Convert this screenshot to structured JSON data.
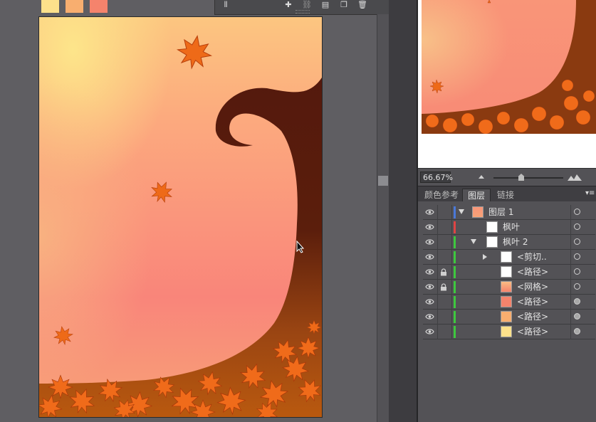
{
  "swatches": [
    {
      "name": "yellow",
      "color": "#fde18b"
    },
    {
      "name": "orange",
      "color": "#f8ae6f"
    },
    {
      "name": "salmon",
      "color": "#f5836c"
    }
  ],
  "toolbar": {
    "icons": [
      "align-icon",
      "transform-icon",
      "link-icon",
      "new-page-icon",
      "duplicate-icon",
      "delete-icon"
    ]
  },
  "navigator": {
    "zoom_value": "66.67%"
  },
  "tabs": [
    {
      "label": "颜色参考",
      "active": false
    },
    {
      "label": "图层",
      "active": true
    },
    {
      "label": "链接",
      "active": false
    }
  ],
  "layers": [
    {
      "name": "图层 1",
      "indent": 0,
      "expand": "down",
      "lock": false,
      "color": "#4a78d8",
      "thumb": "tree",
      "target_filled": false
    },
    {
      "name": "枫叶",
      "indent": 1,
      "expand": "none",
      "lock": false,
      "color": "#e04444",
      "thumb": "white",
      "target_filled": false
    },
    {
      "name": "枫叶 2",
      "indent": 1,
      "expand": "down",
      "lock": false,
      "color": "#3ec83e",
      "thumb": "mini",
      "target_filled": false
    },
    {
      "name": "<剪切..",
      "indent": 2,
      "expand": "right",
      "lock": false,
      "color": "#3ec83e",
      "thumb": "mini",
      "target_filled": false
    },
    {
      "name": "<路径>",
      "indent": 2,
      "expand": "none",
      "lock": true,
      "color": "#3ec83e",
      "thumb": "curve",
      "target_filled": false
    },
    {
      "name": "<网格>",
      "indent": 2,
      "expand": "none",
      "lock": true,
      "color": "#3ec83e",
      "thumb": "mesh",
      "target_filled": false
    },
    {
      "name": "<路径>",
      "indent": 2,
      "expand": "none",
      "lock": false,
      "color": "#3ec83e",
      "thumb": "salmon",
      "target_filled": true
    },
    {
      "name": "<路径>",
      "indent": 2,
      "expand": "none",
      "lock": false,
      "color": "#3ec83e",
      "thumb": "orange",
      "target_filled": true
    },
    {
      "name": "<路径>",
      "indent": 2,
      "expand": "none",
      "lock": false,
      "color": "#3ec83e",
      "thumb": "yellow",
      "target_filled": true
    }
  ]
}
